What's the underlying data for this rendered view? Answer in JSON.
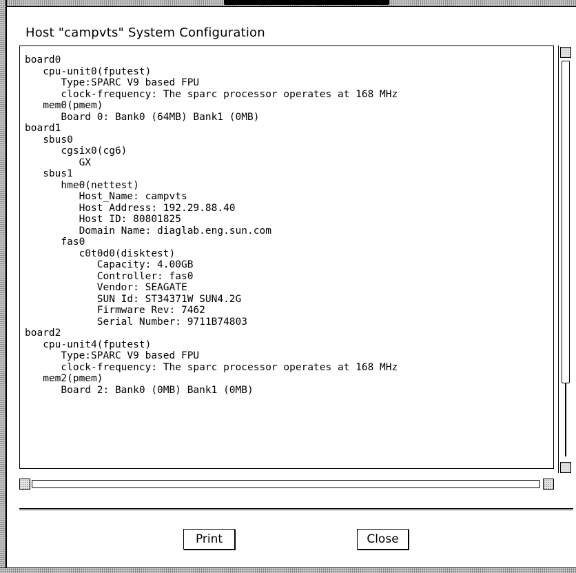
{
  "window": {
    "heading": "Host \"campvts\" System Configuration"
  },
  "config_lines": [
    "board0",
    "   cpu-unit0(fputest)",
    "      Type:SPARC V9 based FPU",
    "      clock-frequency: The sparc processor operates at 168 MHz",
    "   mem0(pmem)",
    "      Board 0: Bank0 (64MB) Bank1 (0MB)",
    "board1",
    "   sbus0",
    "      cgsix0(cg6)",
    "         GX",
    "   sbus1",
    "      hme0(nettest)",
    "         Host_Name: campvts",
    "         Host Address: 192.29.88.40",
    "         Host ID: 80801825",
    "         Domain Name: diaglab.eng.sun.com",
    "      fas0",
    "         c0t0d0(disktest)",
    "            Capacity: 4.00GB",
    "            Controller: fas0",
    "            Vendor: SEAGATE",
    "            SUN Id: ST34371W SUN4.2G",
    "            Firmware Rev: 7462",
    "            Serial Number: 9711B74803",
    "board2",
    "   cpu-unit4(fputest)",
    "      Type:SPARC V9 based FPU",
    "      clock-frequency: The sparc processor operates at 168 MHz",
    "   mem2(pmem)",
    "      Board 2: Bank0 (0MB) Bank1 (0MB)"
  ],
  "buttons": {
    "print_label": "Print",
    "close_label": "Close"
  },
  "icons": {
    "scroll_up": "scroll-up-arrow-icon",
    "scroll_down": "scroll-down-arrow-icon",
    "scroll_left": "scroll-left-arrow-icon",
    "scroll_right": "scroll-right-arrow-icon"
  }
}
